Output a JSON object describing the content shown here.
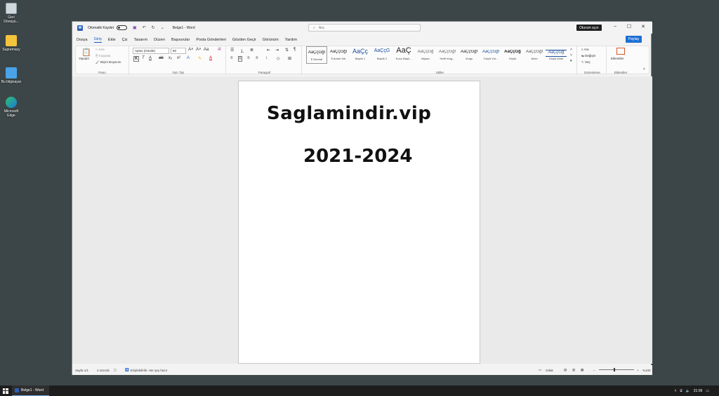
{
  "desktop": {
    "icons": [
      {
        "label": "Geri Dönüşü...",
        "icon": "recycle-bin-icon"
      },
      {
        "label": "Supremacy",
        "icon": "folder-icon"
      },
      {
        "label": "Bu bilgisayar",
        "icon": "computer-icon"
      },
      {
        "label": "Microsoft Edge",
        "icon": "edge-icon"
      }
    ]
  },
  "taskbar": {
    "task_label": "Belge1 - Word",
    "time": "21:09"
  },
  "window": {
    "autosave_label": "Otomatik Kaydet",
    "doc_title": "Belge1 - Word",
    "search_placeholder": "Ara",
    "signin_label": "Oturum açın",
    "share_label": "Paylaş"
  },
  "tabs": [
    "Dosya",
    "Giriş",
    "Ekle",
    "Çiz",
    "Tasarım",
    "Düzen",
    "Başvurular",
    "Posta Gönderileri",
    "Gözden Geçir",
    "Görünüm",
    "Yardım"
  ],
  "active_tab": "Giriş",
  "ribbon": {
    "clipboard": {
      "label": "Pano",
      "paste": "Yapıştır",
      "cut": "Kes",
      "copy": "Kopyala",
      "format_painter": "Biçim Boyacısı"
    },
    "font": {
      "label": "Yazı Tipi",
      "font_name": "Aptos (Gövde)",
      "font_size": "60"
    },
    "paragraph": {
      "label": "Paragraf"
    },
    "styles": {
      "label": "Stiller",
      "items": [
        {
          "preview": "AaÇçĞğI",
          "name": "¶ Normal"
        },
        {
          "preview": "AaÇçĞğI",
          "name": "¶ Aralık Yok"
        },
        {
          "preview": "AaÇç",
          "name": "Başlık 1"
        },
        {
          "preview": "AaÇçG",
          "name": "Başlık 2"
        },
        {
          "preview": "AaÇ",
          "name": "Konu Başlı..."
        },
        {
          "preview": "AaÇçĞğ",
          "name": "Altyazı"
        },
        {
          "preview": "AaÇçĞğI",
          "name": "Hafif Vurg..."
        },
        {
          "preview": "AaÇçĞğI",
          "name": "Vurgu"
        },
        {
          "preview": "AaÇçĞğI",
          "name": "Güçlü Vur..."
        },
        {
          "preview": "AaÇçĞğ",
          "name": "Güçlü"
        },
        {
          "preview": "AaÇçĞğI",
          "name": "Alıntı"
        },
        {
          "preview": "AaÇçĞğ",
          "name": "Güçlü Alıntı"
        }
      ]
    },
    "editing": {
      "label": "Düzenleme",
      "find": "Ara",
      "replace": "Değiştir",
      "select": "Seç"
    },
    "addins": {
      "label": "Eklentiler",
      "button": "Eklentiler"
    }
  },
  "document": {
    "line1": "Saglamindir.vip",
    "line2": "2021-2024"
  },
  "status": {
    "page": "Sayfa 1/1",
    "words": "2 sözcük",
    "accessibility": "Erişilebilirlik: Her şey hazır",
    "focus": "Odak",
    "zoom": "%100"
  }
}
